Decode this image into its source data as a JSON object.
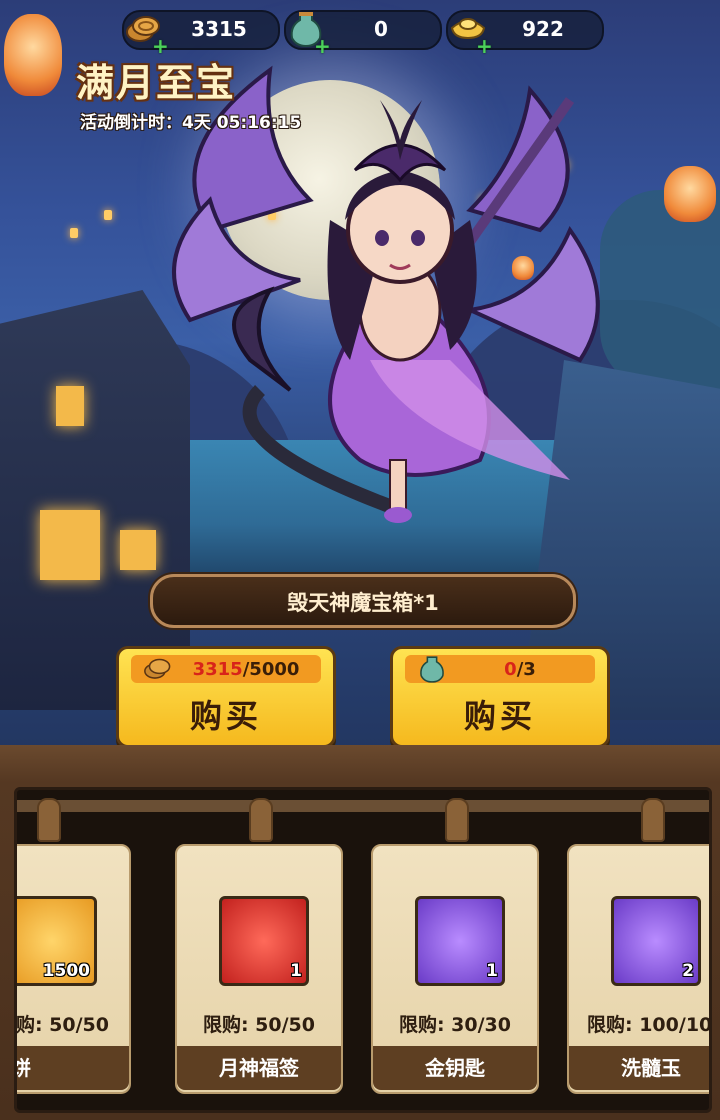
{
  "resources": [
    {
      "icon": "mooncake-coin-icon",
      "value": "3315"
    },
    {
      "icon": "jade-vase-icon",
      "value": "0"
    },
    {
      "icon": "gold-ingot-icon",
      "value": "922"
    }
  ],
  "event": {
    "title": "满月至宝",
    "countdown": "活动倒计时：4天 05:16:15"
  },
  "reward_banner": "毁天神魔宝箱*1",
  "buy_options": [
    {
      "icon": "mooncake-coin-icon",
      "have": "3315",
      "need": "/5000",
      "label": "购买"
    },
    {
      "icon": "jade-vase-icon",
      "have": "0",
      "need": "/3",
      "label": "购买"
    }
  ],
  "shop_items": [
    {
      "icon": "mooncake-icon",
      "qty": "1500",
      "limit": "购: 50/50",
      "name": "月饼",
      "color": "gold"
    },
    {
      "icon": "fortune-slip-icon",
      "qty": "1",
      "limit": "限购: 50/50",
      "name": "月神福签",
      "color": "red"
    },
    {
      "icon": "golden-key-icon",
      "qty": "1",
      "limit": "限购: 30/30",
      "name": "金钥匙",
      "color": "purple"
    },
    {
      "icon": "jade-dragon-icon",
      "qty": "2",
      "limit": "限购: 100/10",
      "name": "洗髓玉",
      "color": "purple"
    }
  ],
  "colors": {
    "accent": "#f5b91e",
    "price_bar": "#f29a21",
    "have_red": "#d8241a"
  }
}
